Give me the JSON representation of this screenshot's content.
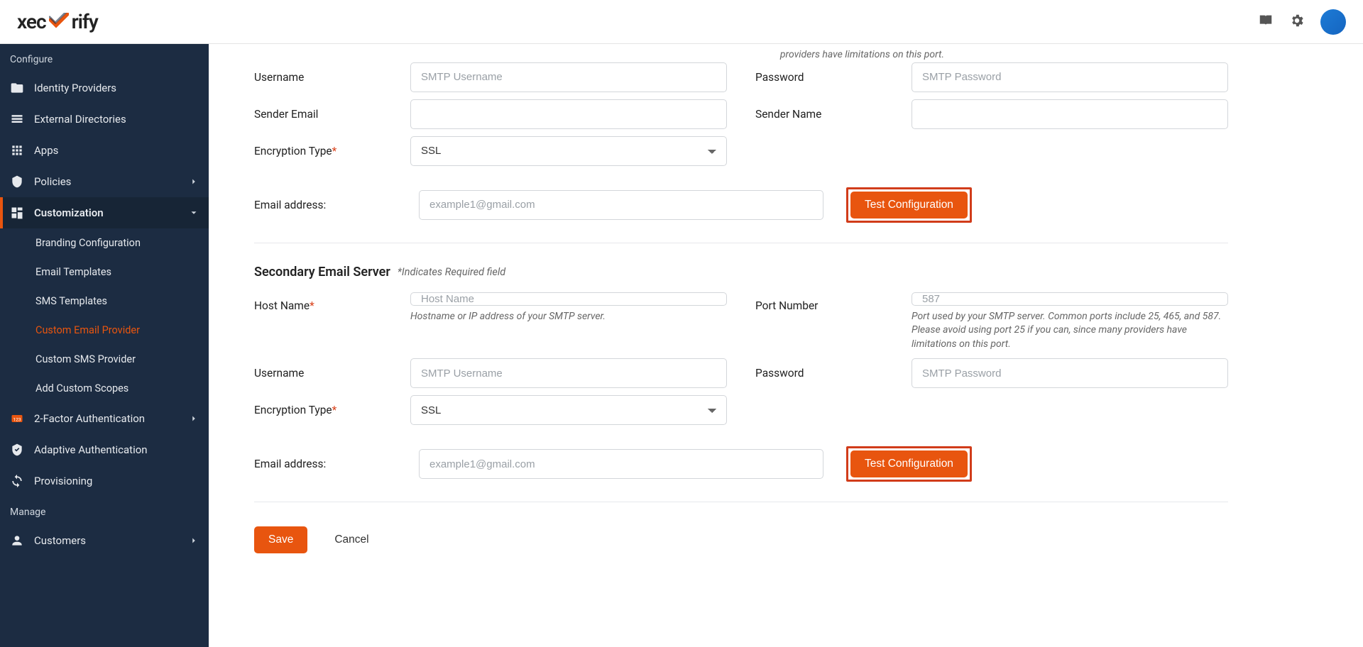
{
  "brand": {
    "name": "xecurify"
  },
  "header_icons": {
    "guide": "guide-icon",
    "settings": "gear-icon"
  },
  "sidebar": {
    "sections": {
      "configure": "Configure",
      "manage": "Manage"
    },
    "items": {
      "identity_providers": "Identity Providers",
      "external_directories": "External Directories",
      "apps": "Apps",
      "policies": "Policies",
      "customization": "Customization",
      "two_factor": "2-Factor Authentication",
      "adaptive_auth": "Adaptive Authentication",
      "provisioning": "Provisioning",
      "customers": "Customers"
    },
    "customization_sub": {
      "branding": "Branding Configuration",
      "email_templates": "Email Templates",
      "sms_templates": "SMS Templates",
      "custom_email": "Custom Email Provider",
      "custom_sms": "Custom SMS Provider",
      "custom_scopes": "Add Custom Scopes"
    }
  },
  "form": {
    "top_help": "providers have limitations on this port.",
    "labels": {
      "username": "Username",
      "password": "Password",
      "sender_email": "Sender Email",
      "sender_name": "Sender Name",
      "encryption_type": "Encryption Type",
      "email_address": "Email address:",
      "host_name": "Host Name",
      "port_number": "Port Number"
    },
    "placeholders": {
      "smtp_username": "SMTP Username",
      "smtp_password": "SMTP Password",
      "email_example": "example1@gmail.com",
      "host_name": "Host Name",
      "port": "587"
    },
    "encryption_value": "SSL",
    "host_help": "Hostname or IP address of your SMTP server.",
    "port_help": "Port used by your SMTP server. Common ports include 25, 465, and 587. Please avoid using port 25 if you can, since many providers have limitations on this port.",
    "secondary_title": "Secondary Email Server",
    "required_hint": "*Indicates Required field",
    "buttons": {
      "test": "Test Configuration",
      "save": "Save",
      "cancel": "Cancel"
    }
  }
}
